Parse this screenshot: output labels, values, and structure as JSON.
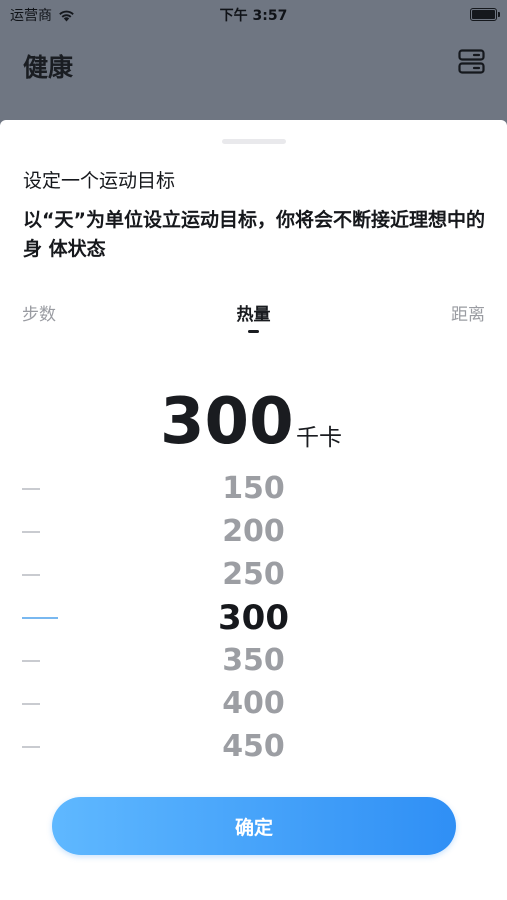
{
  "status_bar": {
    "carrier": "运营商",
    "time": "下午 3:57"
  },
  "background_app": {
    "title": "健康",
    "action_icon": "server-icon"
  },
  "sheet": {
    "title": "设定一个运动目标",
    "description": "以“天”为单位设立运动目标，你将会不断接近理想中的身 体状态",
    "tabs": [
      {
        "label": "步数",
        "selected": false
      },
      {
        "label": "热量",
        "selected": true
      },
      {
        "label": "距离",
        "selected": false
      }
    ],
    "current_value": "300",
    "unit": "千卡",
    "picker_options": [
      "150",
      "200",
      "250",
      "300",
      "350",
      "400",
      "450"
    ],
    "selected_option": "300",
    "confirm_label": "确定"
  },
  "colors": {
    "accent_start": "#5fb8ff",
    "accent_end": "#2f8ff5",
    "selected_tick": "#79b8f0",
    "overlay": "#6f7682"
  }
}
